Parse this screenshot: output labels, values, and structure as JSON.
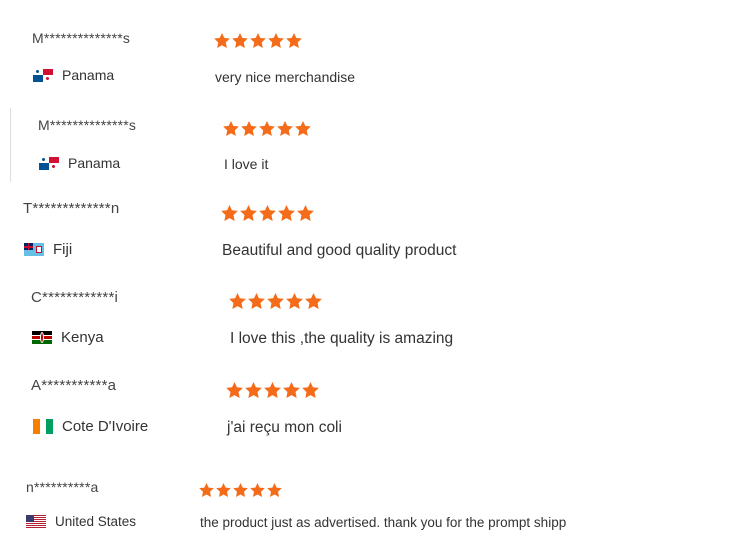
{
  "colors": {
    "star": "#f46c1a",
    "text": "#333333",
    "divider": "#dddddd"
  },
  "reviews": [
    {
      "name": "M**************s",
      "country": "Panama",
      "flag": "panama-flag-icon",
      "rating": 5,
      "comment": "very nice merchandise"
    },
    {
      "name": "M**************s",
      "country": "Panama",
      "flag": "panama-flag-icon",
      "rating": 5,
      "comment": "I love it"
    },
    {
      "name": "T*************n",
      "country": "Fiji",
      "flag": "fiji-flag-icon",
      "rating": 5,
      "comment": "Beautiful and good quality product"
    },
    {
      "name": "C************i",
      "country": "Kenya",
      "flag": "kenya-flag-icon",
      "rating": 5,
      "comment": "I love this ,the quality is amazing"
    },
    {
      "name": "A***********a",
      "country": "Cote D'Ivoire",
      "flag": "cote-divoire-flag-icon",
      "rating": 5,
      "comment": "j'ai reçu mon coli"
    },
    {
      "name": "n**********a",
      "country": "United States",
      "flag": "us-flag-icon",
      "rating": 5,
      "comment": "the product just as advertised. thank you for the prompt shipp"
    }
  ]
}
